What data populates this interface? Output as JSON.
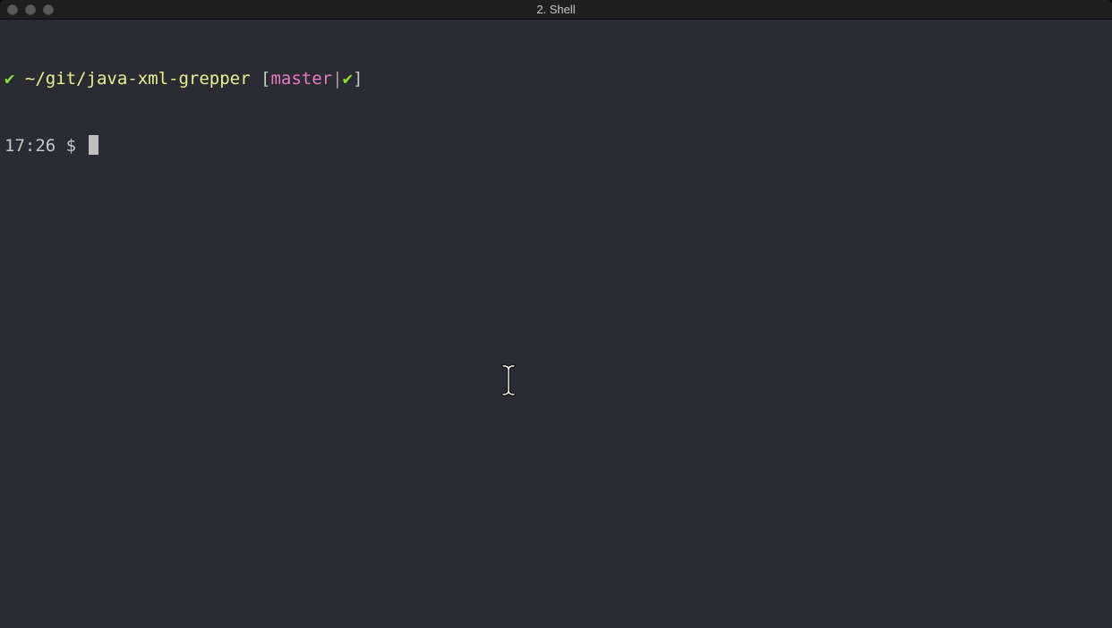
{
  "window": {
    "title": "2. Shell"
  },
  "terminal": {
    "prompt_line": {
      "status_mark": "✔",
      "path": "~/git/java-xml-grepper",
      "open_bracket": "[",
      "branch": "master",
      "separator": "|",
      "git_status_mark": "✔",
      "close_bracket": "]"
    },
    "input_line": {
      "time": "17:26",
      "prompt_symbol": "$"
    }
  },
  "colors": {
    "background": "#2a2b33",
    "titlebar": "#1f1f1f",
    "ok_green": "#8ae234",
    "path_yellow": "#e9f291",
    "branch_pink": "#e87bbf",
    "text": "#c5c8c6"
  },
  "icons": {
    "close": "close-button",
    "minimize": "minimize-button",
    "zoom": "zoom-button",
    "mouse_pointer": "ibeam-cursor-icon"
  }
}
